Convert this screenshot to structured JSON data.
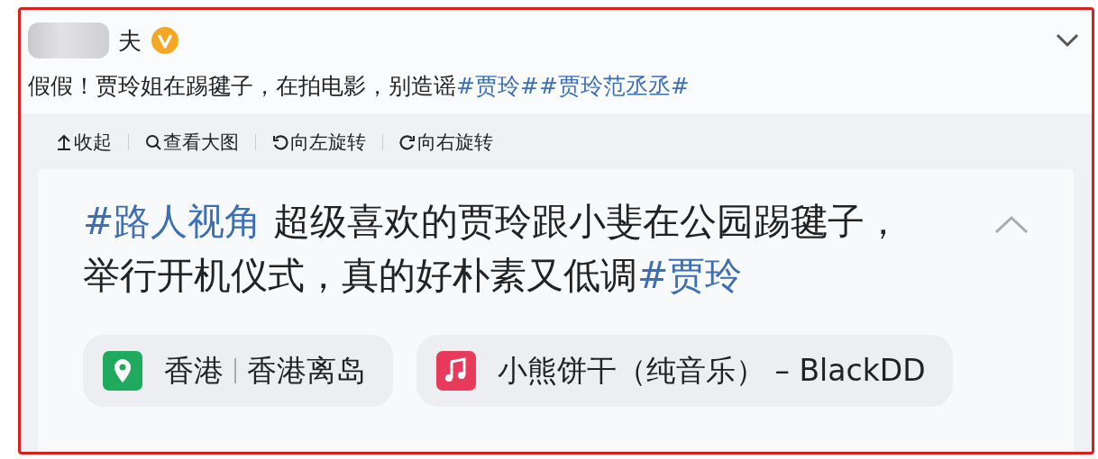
{
  "post": {
    "username_visible": "夫",
    "verified": true,
    "text": "假假！贾玲姐在踢毽子，在拍电影，别造谣",
    "tags": [
      "#贾玲#",
      "#贾玲范丞丞#"
    ]
  },
  "image_toolbar": [
    {
      "kind": "collapse",
      "label": "收起"
    },
    {
      "kind": "zoom",
      "label": "查看大图"
    },
    {
      "kind": "rotate-left",
      "label": "向左旋转"
    },
    {
      "kind": "rotate-right",
      "label": "向右旋转"
    }
  ],
  "card": {
    "segments": [
      {
        "kind": "tag",
        "text": "#路人视角"
      },
      {
        "kind": "text",
        "text": " 超级喜欢的贾玲跟小斐在公园踢毽子，举行开机仪式，真的好朴素又低调"
      },
      {
        "kind": "tag",
        "text": "#贾玲"
      }
    ],
    "chips": [
      {
        "kind": "location",
        "text": "香港",
        "detail": "香港离岛"
      },
      {
        "kind": "music",
        "text": "小熊饼干（纯音乐） – BlackDD"
      }
    ]
  }
}
